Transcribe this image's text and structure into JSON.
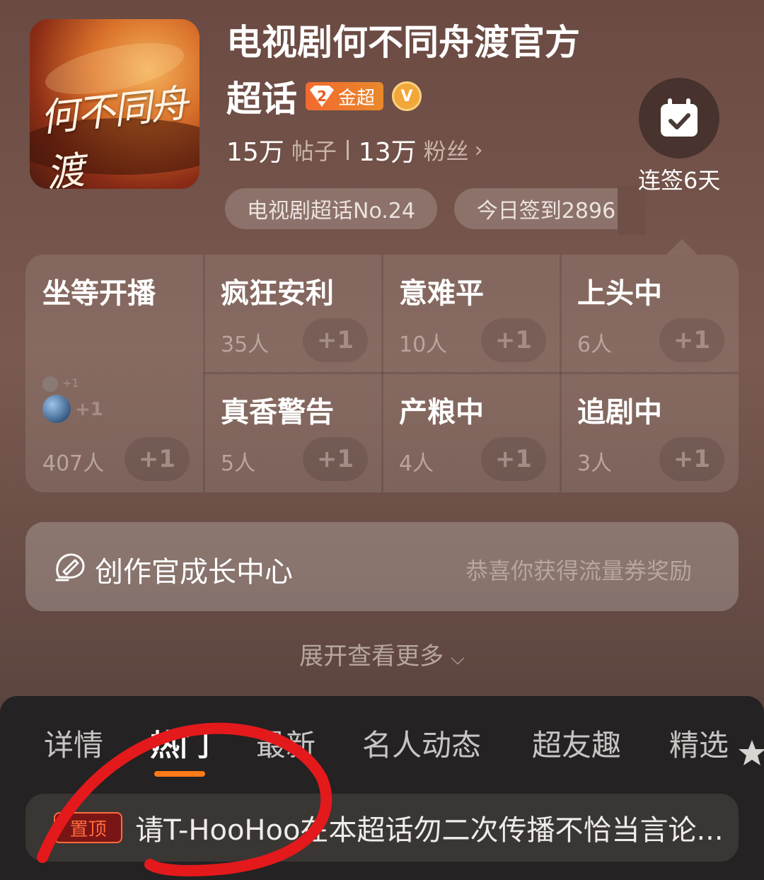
{
  "header": {
    "topic_title": "电视剧何不同舟渡官方",
    "topic_title_line2": "超话",
    "cover_text": "何不同舟渡",
    "badge_level": "2",
    "badge_label": "金超",
    "verified_badge": "V",
    "posts_count": "15万",
    "posts_label": "帖子",
    "fans_count": "13万",
    "fans_label": "粉丝",
    "fans_chevron": "›",
    "rank_chip": "电视剧超话No.24",
    "checkin_chip": "今日签到2896"
  },
  "checkin": {
    "icon": "calendar-check-icon",
    "label": "连签6天"
  },
  "moods": [
    {
      "name": "坐等开播",
      "count": "407人",
      "plus": "+1"
    },
    {
      "name": "疯狂安利",
      "count": "35人",
      "plus": "+1"
    },
    {
      "name": "意难平",
      "count": "10人",
      "plus": "+1"
    },
    {
      "name": "上头中",
      "count": "6人",
      "plus": "+1"
    },
    {
      "name": "真香警告",
      "count": "5人",
      "plus": "+1"
    },
    {
      "name": "产粮中",
      "count": "4人",
      "plus": "+1"
    },
    {
      "name": "追剧中",
      "count": "3人",
      "plus": "+1"
    }
  ],
  "mood_avatars": {
    "small_plus": "+1",
    "large_plus": "+1"
  },
  "growth": {
    "label": "创作官成长中心",
    "hint": "恭喜你获得流量券奖励"
  },
  "expand": {
    "label": "展开查看更多",
    "chevron": "⌵"
  },
  "tabs": [
    {
      "label": "详情",
      "active": false
    },
    {
      "label": "热门",
      "active": true
    },
    {
      "label": "最新",
      "active": false
    },
    {
      "label": "名人动态",
      "active": false
    },
    {
      "label": "超友趣",
      "active": false
    },
    {
      "label": "精选",
      "active": false
    }
  ],
  "pinned": {
    "tag": "置顶",
    "text": "请T-HooHoo在本超话勿二次传播不恰当言论..."
  },
  "colors": {
    "accent_orange": "#ff7a18",
    "annotation_red": "#e3191c",
    "gold_badge": "#f26a2e"
  }
}
